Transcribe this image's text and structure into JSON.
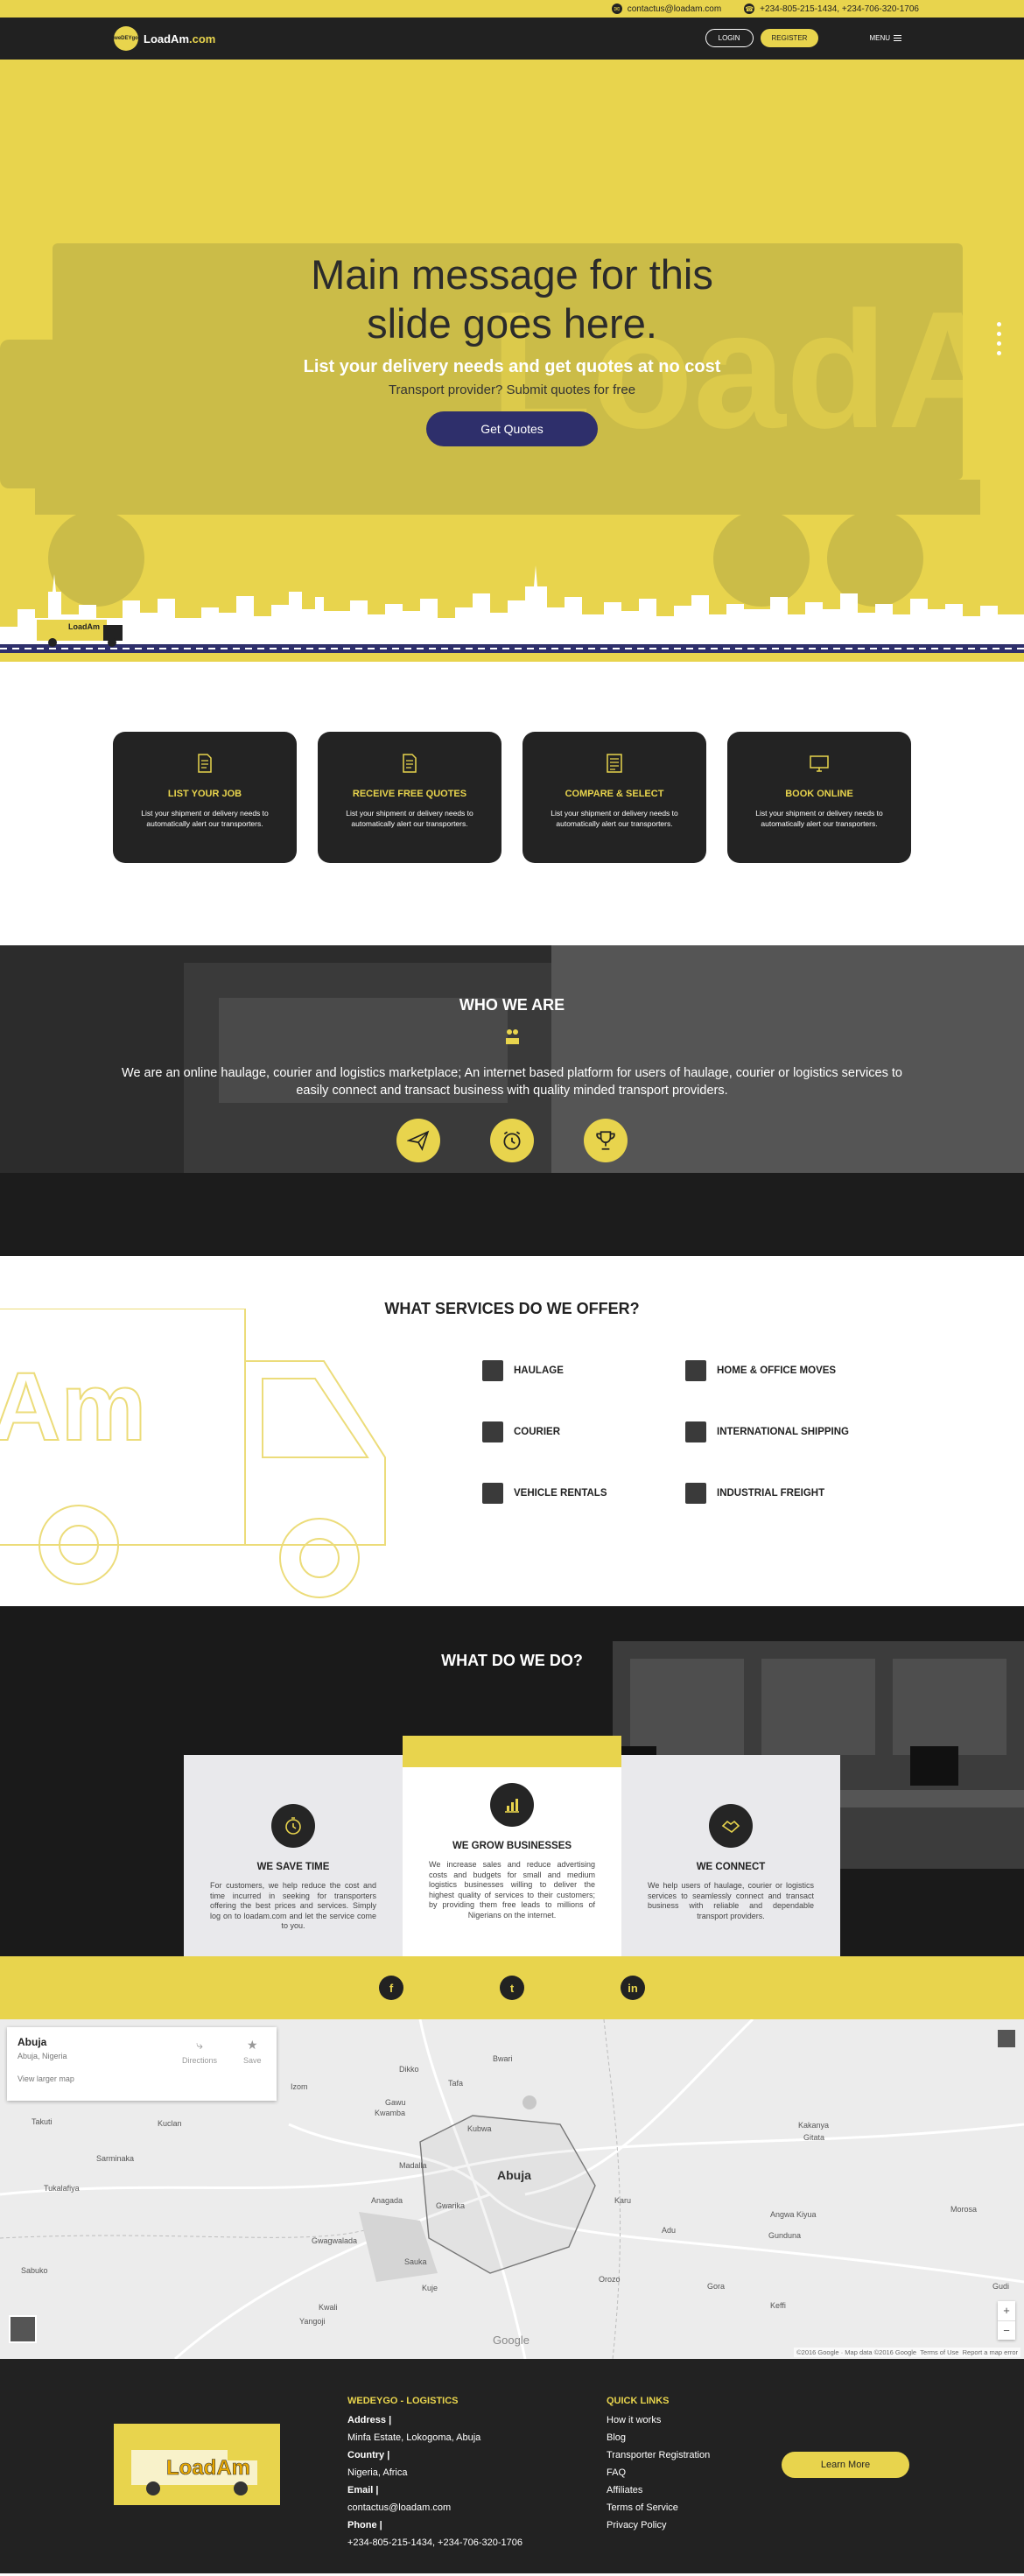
{
  "topbar": {
    "email": "contactus@loadam.com",
    "phone": "+234-805-215-1434, +234-706-320-1706"
  },
  "nav": {
    "logo_badge": "weDEYgo",
    "logo_name": "LoadAm",
    "logo_tld": ".com",
    "login": "LOGIN",
    "register": "REGISTER",
    "menu": "MENU"
  },
  "hero": {
    "title_line1": "Main message for this",
    "title_line2": "slide goes here.",
    "subtitle": "List your delivery needs and get quotes at no cost",
    "subtitle2": "Transport provider? Submit quotes for free",
    "cta": "Get Quotes",
    "truck_label": "LoadAm"
  },
  "steps": [
    {
      "title": "LIST YOUR JOB",
      "text": "List your shipment or delivery needs to automatically alert our transporters.",
      "icon": "document-icon"
    },
    {
      "title": "RECEIVE FREE QUOTES",
      "text": "List your shipment or delivery needs to automatically alert our transporters.",
      "icon": "document-icon"
    },
    {
      "title": "COMPARE & SELECT",
      "text": "List your shipment or delivery needs to automatically alert our transporters.",
      "icon": "document-list-icon"
    },
    {
      "title": "BOOK ONLINE",
      "text": "List your shipment or delivery needs to automatically alert our transporters.",
      "icon": "monitor-icon"
    }
  ],
  "who": {
    "title": "WHO WE ARE",
    "text": "We are an online haulage, courier and logistics marketplace; An internet based platform for users of haulage, courier or logistics services to easily connect and transact business with quality minded transport providers.",
    "icons": [
      "paper-plane-icon",
      "alarm-clock-icon",
      "trophy-icon"
    ]
  },
  "services": {
    "title": "WHAT SERVICES DO WE OFFER?",
    "items": [
      "HAULAGE",
      "HOME & OFFICE MOVES",
      "COURIER",
      "INTERNATIONAL SHIPPING",
      "VEHICLE RENTALS",
      "INDUSTRIAL FREIGHT"
    ],
    "truck_text": "Am"
  },
  "whatdo": {
    "title": "WHAT DO WE DO?",
    "cards": [
      {
        "title": "WE SAVE TIME",
        "text": "For customers, we help reduce the cost and time incurred in seeking for transporters offering the best prices and services. Simply log on to loadam.com and let the service come to you.",
        "icon": "stopwatch-icon"
      },
      {
        "title": "WE GROW BUSINESSES",
        "text": "We increase sales and reduce advertising costs and budgets for small and medium logistics businesses willing to deliver the highest quality of services to their customers; by providing them free leads to millions of Nigerians on the internet.",
        "icon": "bar-chart-icon"
      },
      {
        "title": "WE CONNECT",
        "text": "We help users of haulage, courier or logistics services to seamlessly connect and transact business with reliable and dependable transport providers.",
        "icon": "handshake-icon"
      }
    ]
  },
  "social": [
    {
      "name": "facebook-icon",
      "glyph": "f"
    },
    {
      "name": "twitter-icon",
      "glyph": "t"
    },
    {
      "name": "linkedin-icon",
      "glyph": "in"
    }
  ],
  "map": {
    "place": "Abuja",
    "address": "Abuja, Nigeria",
    "larger": "View larger map",
    "directions": "Directions",
    "save": "Save",
    "city": "Abuja",
    "labels": [
      "Bwari",
      "Dikko",
      "Tafa",
      "Izom",
      "Gawu",
      "Kwamba",
      "Takuti",
      "Kuclan",
      "Sarminaka",
      "Tukalafiya",
      "Madalla",
      "Anagada",
      "Gwagwalada",
      "Sauka",
      "Kuje",
      "Kwali",
      "Yangoji",
      "Sabuko",
      "Kakanya",
      "Gitata",
      "Karu",
      "Angwa Kiyua",
      "Gunduna",
      "Adu",
      "Orozo",
      "Gora",
      "Keffi",
      "Morosa",
      "Gudi",
      "Kubwa",
      "Gwarika"
    ],
    "attribution": "©2016 Google · Map data ©2016 Google",
    "terms": "Terms of Use",
    "report": "Report a map error",
    "google": "Google",
    "zoom_in": "+",
    "zoom_out": "−"
  },
  "footer": {
    "company_title": "WEDEYGO - LOGISTICS",
    "address_label": "Address |",
    "address": "Minfa Estate, Lokogoma, Abuja",
    "country_label": "Country |",
    "country": "Nigeria, Africa",
    "email_label": "Email |",
    "email": "contactus@loadam.com",
    "phone_label": "Phone |",
    "phone": "+234-805-215-1434, +234-706-320-1706",
    "links_title": "QUICK LINKS",
    "links": [
      "How it works",
      "Blog",
      "Transporter Registration",
      "FAQ",
      "Affiliates",
      "Terms of Service",
      "Privacy Policy"
    ],
    "learn_more": "Learn More",
    "logo_text": "LoadAm"
  },
  "colors": {
    "accent": "#e8d44d",
    "dark": "#222222",
    "button": "#2e2f6b"
  }
}
